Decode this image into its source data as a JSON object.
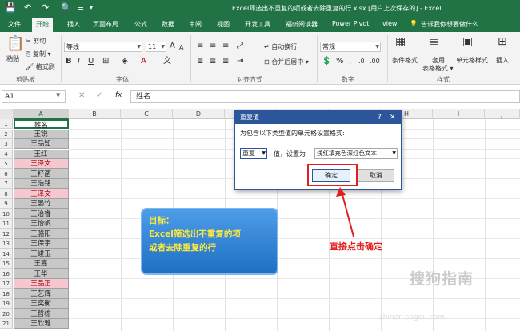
{
  "titlebar": {
    "title": "Excel筛选出不重复的项或者去除重复的行.xlsx [用户上次保存的] - Excel",
    "save_glyph": "💾",
    "undo_glyph": "↶",
    "redo_glyph": "↷",
    "preview_glyph": "🔍",
    "more_glyph": "≡",
    "overflow_glyph": "▾"
  },
  "menu": {
    "items": [
      "文件",
      "开始",
      "插入",
      "页面布局",
      "公式",
      "数据",
      "审阅",
      "视图",
      "开发工具",
      "福昕阅读器",
      "Power Pivot",
      "view"
    ],
    "tell": "告诉我你想要做什么"
  },
  "ribbon": {
    "clipboard": {
      "cut": "剪切",
      "copy": "复制 ▾",
      "format_painter": "格式刷",
      "paste": "粘贴",
      "group": "剪贴板"
    },
    "font": {
      "name": "等线",
      "size": "11",
      "grow": "A",
      "shrink": "A",
      "bold": "B",
      "italic": "I",
      "underline": "U",
      "group": "字体",
      "wen": "文"
    },
    "align": {
      "wrap": "自动换行",
      "merge": "合并后居中 ▾",
      "group": "对齐方式"
    },
    "number": {
      "format": "常规",
      "percent": "%",
      "comma": ",",
      "group": "数字"
    },
    "styles": {
      "conditional": "条件格式",
      "table": "套用",
      "table2": "表格格式 ▾",
      "cell_styles": "单元格样式",
      "group": "样式"
    },
    "cells": {
      "insert": "插入"
    }
  },
  "formula": {
    "namebox": "A1",
    "cancel": "✕",
    "enter": "✓",
    "fx": "fx",
    "value": "姓名"
  },
  "columns": [
    "A",
    "B",
    "C",
    "D",
    "E",
    "F",
    "G",
    "H",
    "I",
    "J"
  ],
  "rows": [
    {
      "num": "1",
      "name": "姓名",
      "dup": false
    },
    {
      "num": "2",
      "name": "王锐",
      "dup": false
    },
    {
      "num": "3",
      "name": "王品知",
      "dup": false
    },
    {
      "num": "4",
      "name": "王红",
      "dup": false
    },
    {
      "num": "5",
      "name": "王泽文",
      "dup": true
    },
    {
      "num": "6",
      "name": "王籽菡",
      "dup": false
    },
    {
      "num": "7",
      "name": "王浩铭",
      "dup": false
    },
    {
      "num": "8",
      "name": "王泽文",
      "dup": true
    },
    {
      "num": "9",
      "name": "王晏竹",
      "dup": false
    },
    {
      "num": "10",
      "name": "王治睿",
      "dup": false
    },
    {
      "num": "11",
      "name": "王怡帆",
      "dup": false
    },
    {
      "num": "12",
      "name": "王骆阳",
      "dup": false
    },
    {
      "num": "13",
      "name": "王保宇",
      "dup": false
    },
    {
      "num": "14",
      "name": "王峻玉",
      "dup": false
    },
    {
      "num": "15",
      "name": "王嘉",
      "dup": false
    },
    {
      "num": "16",
      "name": "王华",
      "dup": false
    },
    {
      "num": "17",
      "name": "王品正",
      "dup": true
    },
    {
      "num": "18",
      "name": "王艺辉",
      "dup": false
    },
    {
      "num": "19",
      "name": "王奕衡",
      "dup": false
    },
    {
      "num": "20",
      "name": "王哲栋",
      "dup": false
    },
    {
      "num": "21",
      "name": "王欣雅",
      "dup": false
    }
  ],
  "dialog": {
    "title": "重复值",
    "help": "?",
    "close": "✕",
    "description": "为包含以下类型值的单元格设置格式:",
    "dup_value": "重复",
    "set_label": "值，设置为",
    "format_value": "浅红填充色深红色文本",
    "ok": "确定",
    "cancel": "取消"
  },
  "callout": {
    "line1": "目标：",
    "line2": "Excel筛选出不重复的项",
    "line3": "或者去除重复的行"
  },
  "annotation": {
    "text": "直接点击确定"
  },
  "watermark": {
    "text": "搜狗指南",
    "url": "zhinan.sogou.com"
  },
  "colors": {
    "excel_green": "#217346",
    "dup_fill": "#f5c7ce",
    "dup_text": "#9c0006",
    "dialog_blue": "#2b579a",
    "annotation_red": "#e02020",
    "callout_text": "#ffeb3b"
  }
}
